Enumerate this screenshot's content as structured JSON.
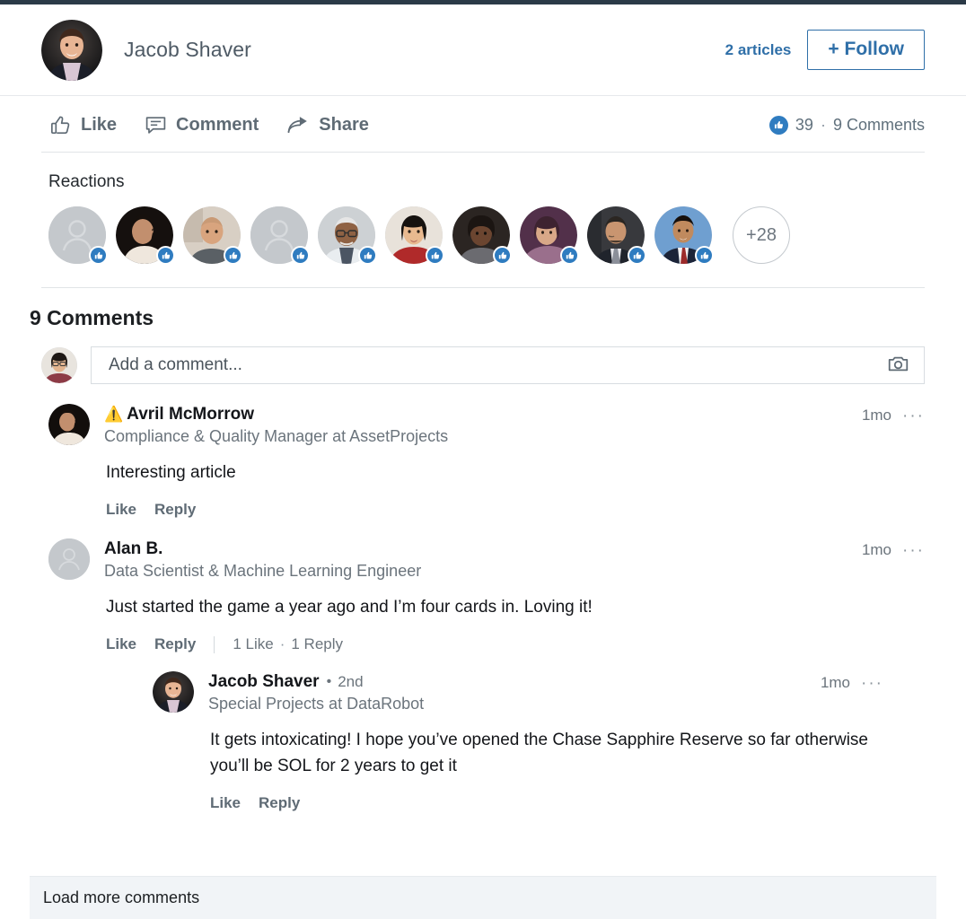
{
  "top_accent_color": "#2b3a47",
  "brand_color": "#2f6fa8",
  "header": {
    "author_name": "Jacob Shaver",
    "avatar_name": "jacob-shaver-avatar",
    "articles_count": "2 articles",
    "follow_label": "+ Follow"
  },
  "action_bar": {
    "actions": [
      {
        "label": "Like",
        "icon": "thumbs-up-icon"
      },
      {
        "label": "Comment",
        "icon": "comment-bubble-icon"
      },
      {
        "label": "Share",
        "icon": "share-arrow-icon"
      }
    ],
    "reaction_count": "39",
    "separator": "·",
    "comment_count": "9 Comments"
  },
  "reactions": {
    "title": "Reactions",
    "avatars": [
      {
        "name": "reactor-avatar-1",
        "type": "placeholder",
        "reaction": "like"
      },
      {
        "name": "reactor-avatar-2",
        "type": "photo-dark-woman",
        "reaction": "like"
      },
      {
        "name": "reactor-avatar-3",
        "type": "photo-bald-man",
        "reaction": "like"
      },
      {
        "name": "reactor-avatar-4",
        "type": "placeholder",
        "reaction": "like"
      },
      {
        "name": "reactor-avatar-5",
        "type": "photo-glasses-man",
        "reaction": "like"
      },
      {
        "name": "reactor-avatar-6",
        "type": "photo-woman-red",
        "reaction": "like"
      },
      {
        "name": "reactor-avatar-7",
        "type": "photo-woman-dark",
        "reaction": "like"
      },
      {
        "name": "reactor-avatar-8",
        "type": "photo-person-purple",
        "reaction": "like"
      },
      {
        "name": "reactor-avatar-9",
        "type": "photo-suit-man",
        "reaction": "like"
      },
      {
        "name": "reactor-avatar-10",
        "type": "photo-blue-suit-man",
        "reaction": "like"
      }
    ],
    "overflow_label": "+28"
  },
  "comments_section": {
    "heading": "9 Comments",
    "composer": {
      "avatar_name": "current-user-avatar",
      "value": "",
      "placeholder": "Add a comment...",
      "camera_icon": "camera-icon"
    },
    "comments": [
      {
        "avatar_name": "avril-mcmorrow-avatar",
        "warning_icon": "⚠️",
        "name": "Avril McMorrow",
        "degree": "",
        "headline": "Compliance & Quality Manager at AssetProjects",
        "time": "1mo",
        "menu": "···",
        "text": "Interesting article",
        "like_label": "Like",
        "reply_label": "Reply",
        "likes_stat": "",
        "replies_stat": "",
        "stat_separator": "",
        "replies": []
      },
      {
        "avatar_name": "alan-b-avatar",
        "warning_icon": "",
        "name": "Alan B.",
        "degree": "",
        "headline": "Data Scientist & Machine Learning Engineer",
        "time": "1mo",
        "menu": "···",
        "text": "Just started the game a year ago and I’m four cards in. Loving it!",
        "like_label": "Like",
        "reply_label": "Reply",
        "likes_stat": "1 Like",
        "replies_stat": "1 Reply",
        "stat_separator": "·",
        "replies": [
          {
            "avatar_name": "jacob-shaver-reply-avatar",
            "warning_icon": "",
            "name": "Jacob Shaver",
            "degree": "2nd",
            "dot": "•",
            "headline": "Special Projects at DataRobot",
            "time": "1mo",
            "menu": "···",
            "text": "It gets intoxicating! I hope you’ve opened the Chase Sapphire Reserve so far otherwise you’ll be SOL for 2 years to get it",
            "like_label": "Like",
            "reply_label": "Reply"
          }
        ]
      }
    ],
    "load_more_label": "Load more comments"
  }
}
